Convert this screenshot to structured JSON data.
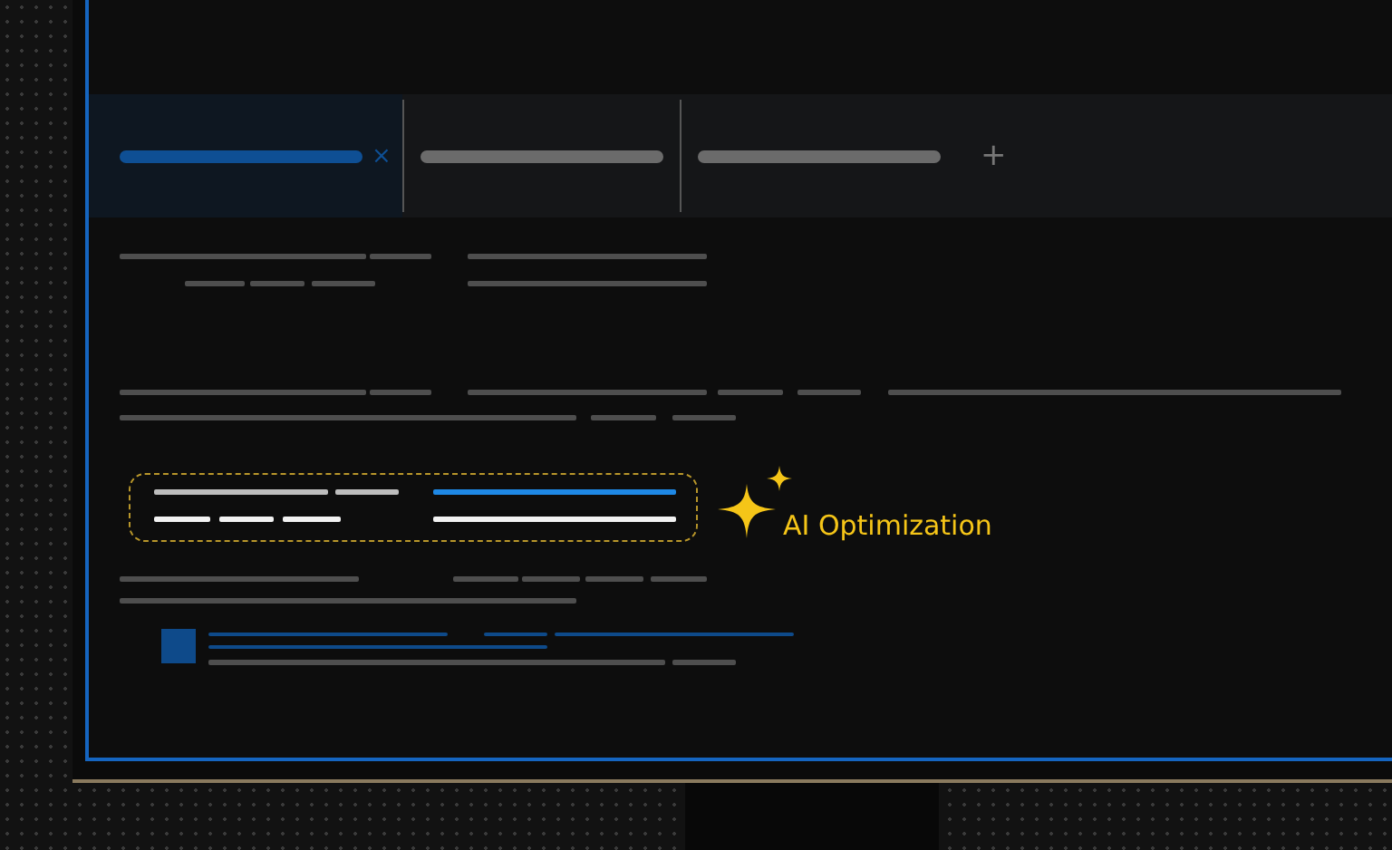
{
  "tabs": [
    {
      "selected": true,
      "close": "×"
    },
    {
      "selected": false
    },
    {
      "selected": false
    }
  ],
  "new_tab": "+",
  "callout": {
    "label": "AI Optimization"
  }
}
